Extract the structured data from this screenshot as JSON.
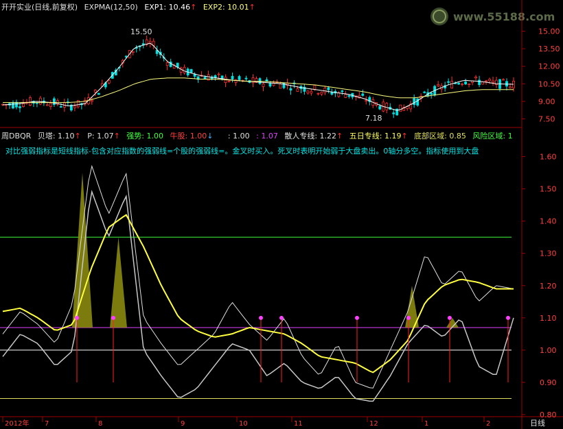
{
  "header": {
    "stock_name": "开开实业",
    "period_info": "(日线,前复权)",
    "indicator": "EXPMA(12,50)",
    "exp1_label": "EXP1: 10.46",
    "exp2_label": "EXP2: 10.01",
    "exp_arrow": "↑"
  },
  "watermark": {
    "text": "www.55188.com"
  },
  "price_axis": {
    "ticks": [
      "15.00",
      "13.50",
      "12.00",
      "10.50",
      "9.00",
      "7.50"
    ]
  },
  "price_annotations": {
    "high": "15.50",
    "low": "7.18"
  },
  "indicator_header": {
    "name": "周DBQR",
    "beita": "贝塔: 1.10",
    "p": "P: 1.07",
    "qiangshi": "强势: 1.00",
    "niugu": "牛股: 1.00",
    "blank": ": 1.00",
    "val2": ": 1.07",
    "sanren": "散人专线: 1.22",
    "wuri": "五日专线: 1.19",
    "dibu": "底部区域: 0.85",
    "fengxian": "风险区域: 1",
    "arrow_up": "↑",
    "arrow_down": "↓"
  },
  "description": "对比强弱指标是短线指标-包含对应指数的强弱线=个股的强弱线=。金叉时买入。死叉时表明开始弱于大盘卖出。0轴分多空。指标使用到大盘",
  "indicator_axis": {
    "ticks": [
      "1.60",
      "1.50",
      "1.40",
      "1.30",
      "1.20",
      "1.10",
      "1.00",
      "0.90",
      "0.80"
    ]
  },
  "x_axis": {
    "labels": [
      "2012年",
      "7",
      "8",
      "9",
      "10",
      "11",
      "12",
      "1",
      "2"
    ],
    "period_tab": "日线"
  },
  "chart_data": [
    {
      "type": "line",
      "title": "开开实业 EXPMA(12,50)",
      "ylim": [
        7.0,
        16.5
      ],
      "series": [
        {
          "name": "EXP1",
          "values": [
            8.7,
            8.8,
            9.0,
            8.9,
            8.6,
            8.8,
            10.2,
            11.8,
            13.6,
            14.0,
            12.4,
            11.6,
            11.2,
            11.0,
            10.8,
            10.7,
            10.6,
            10.5,
            10.2,
            10.0,
            9.8,
            9.6,
            9.2,
            8.6,
            8.2,
            8.9,
            9.8,
            10.4,
            10.8,
            10.7,
            10.5,
            10.46
          ]
        },
        {
          "name": "EXP2",
          "values": [
            8.9,
            8.9,
            8.9,
            8.9,
            8.9,
            9.0,
            9.4,
            9.9,
            10.5,
            10.9,
            11.0,
            11.0,
            10.9,
            10.9,
            10.8,
            10.7,
            10.7,
            10.6,
            10.5,
            10.4,
            10.2,
            10.0,
            9.8,
            9.5,
            9.3,
            9.3,
            9.5,
            9.7,
            9.9,
            10.0,
            10.0,
            10.01
          ]
        }
      ]
    },
    {
      "type": "line",
      "title": "周DBQR",
      "ylim": [
        0.8,
        1.65
      ],
      "series": [
        {
          "name": "散人专线",
          "values": [
            1.05,
            1.12,
            1.08,
            1.02,
            1.15,
            1.58,
            1.42,
            1.55,
            1.1,
            1.02,
            0.95,
            1.0,
            1.05,
            1.15,
            1.08,
            1.03,
            1.1,
            0.98,
            0.92,
            1.02,
            0.9,
            0.88,
            1.0,
            1.12,
            1.3,
            1.2,
            1.25,
            1.15,
            1.2,
            1.19
          ]
        },
        {
          "name": "五日专线",
          "values": [
            1.12,
            1.13,
            1.1,
            1.06,
            1.08,
            1.25,
            1.38,
            1.42,
            1.32,
            1.2,
            1.1,
            1.06,
            1.04,
            1.05,
            1.07,
            1.06,
            1.05,
            1.02,
            0.98,
            0.97,
            0.96,
            0.93,
            0.97,
            1.03,
            1.15,
            1.2,
            1.22,
            1.21,
            1.19,
            1.19
          ]
        },
        {
          "name": "贝塔",
          "values": [
            0.98,
            1.05,
            1.02,
            0.95,
            1.0,
            1.5,
            1.35,
            1.48,
            1.0,
            0.92,
            0.85,
            0.88,
            0.95,
            1.02,
            1.0,
            0.92,
            0.96,
            0.9,
            0.88,
            0.92,
            0.85,
            0.84,
            0.92,
            1.02,
            1.08,
            1.04,
            1.1,
            0.95,
            0.92,
            1.1
          ]
        }
      ],
      "reference_lines": [
        1.35,
        1.07,
        1.0,
        0.85
      ]
    }
  ]
}
